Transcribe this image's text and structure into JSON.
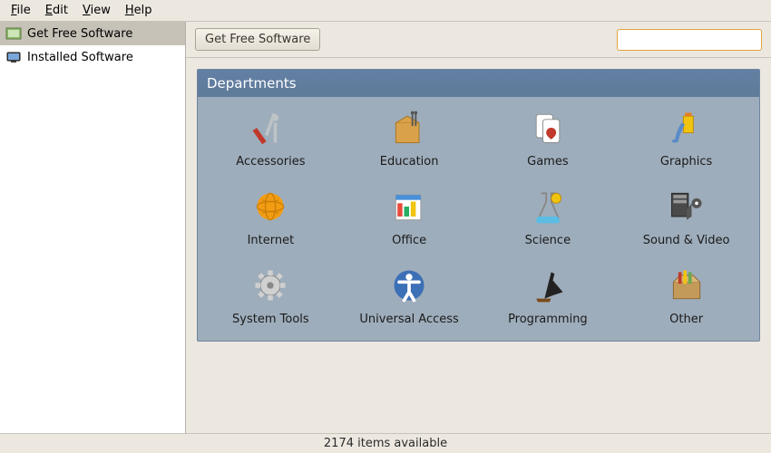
{
  "menu": [
    "File",
    "Edit",
    "View",
    "Help"
  ],
  "sidebar": {
    "items": [
      {
        "label": "Get Free Software",
        "icon": "get-free-software-icon",
        "active": true
      },
      {
        "label": "Installed Software",
        "icon": "installed-software-icon",
        "active": false
      }
    ]
  },
  "topbar": {
    "breadcrumb": "Get Free Software",
    "search_placeholder": ""
  },
  "departments": {
    "title": "Departments",
    "items": [
      {
        "label": "Accessories",
        "icon": "accessories-icon"
      },
      {
        "label": "Education",
        "icon": "education-icon"
      },
      {
        "label": "Games",
        "icon": "games-icon"
      },
      {
        "label": "Graphics",
        "icon": "graphics-icon"
      },
      {
        "label": "Internet",
        "icon": "internet-icon"
      },
      {
        "label": "Office",
        "icon": "office-icon"
      },
      {
        "label": "Science",
        "icon": "science-icon"
      },
      {
        "label": "Sound & Video",
        "icon": "sound-video-icon"
      },
      {
        "label": "System Tools",
        "icon": "system-tools-icon"
      },
      {
        "label": "Universal Access",
        "icon": "universal-access-icon"
      },
      {
        "label": "Programming",
        "icon": "programming-icon"
      },
      {
        "label": "Other",
        "icon": "other-icon"
      }
    ]
  },
  "status": "2174 items available"
}
